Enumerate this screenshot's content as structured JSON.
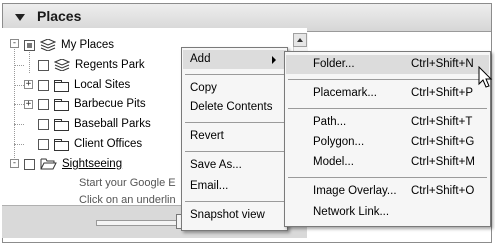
{
  "panel": {
    "title": "Places"
  },
  "tree": {
    "root": {
      "label": "My Places"
    },
    "items": [
      {
        "label": "Regents Park"
      },
      {
        "label": "Local Sites"
      },
      {
        "label": "Barbecue Pits"
      },
      {
        "label": "Baseball Parks"
      },
      {
        "label": "Client Offices"
      },
      {
        "label": "Sightseeing"
      }
    ],
    "hint_lines": [
      "Start your Google E",
      "Click on an underlin"
    ]
  },
  "context_menu": {
    "items": [
      "Add",
      "Copy",
      "Delete Contents",
      "Revert",
      "Save As...",
      "Email...",
      "Snapshot view"
    ]
  },
  "submenu": {
    "items": [
      {
        "label": "Folder...",
        "shortcut": "Ctrl+Shift+N"
      },
      {
        "label": "Placemark...",
        "shortcut": "Ctrl+Shift+P"
      },
      {
        "label": "Path...",
        "shortcut": "Ctrl+Shift+T"
      },
      {
        "label": "Polygon...",
        "shortcut": "Ctrl+Shift+G"
      },
      {
        "label": "Model...",
        "shortcut": "Ctrl+Shift+M"
      },
      {
        "label": "Image Overlay...",
        "shortcut": "Ctrl+Shift+O"
      },
      {
        "label": "Network Link...",
        "shortcut": ""
      }
    ]
  },
  "icons": {
    "collapse": "collapse-triangle-icon",
    "folder": "folder-icon",
    "placemark_stack": "layers-icon",
    "cursor": "mouse-pointer-icon"
  }
}
